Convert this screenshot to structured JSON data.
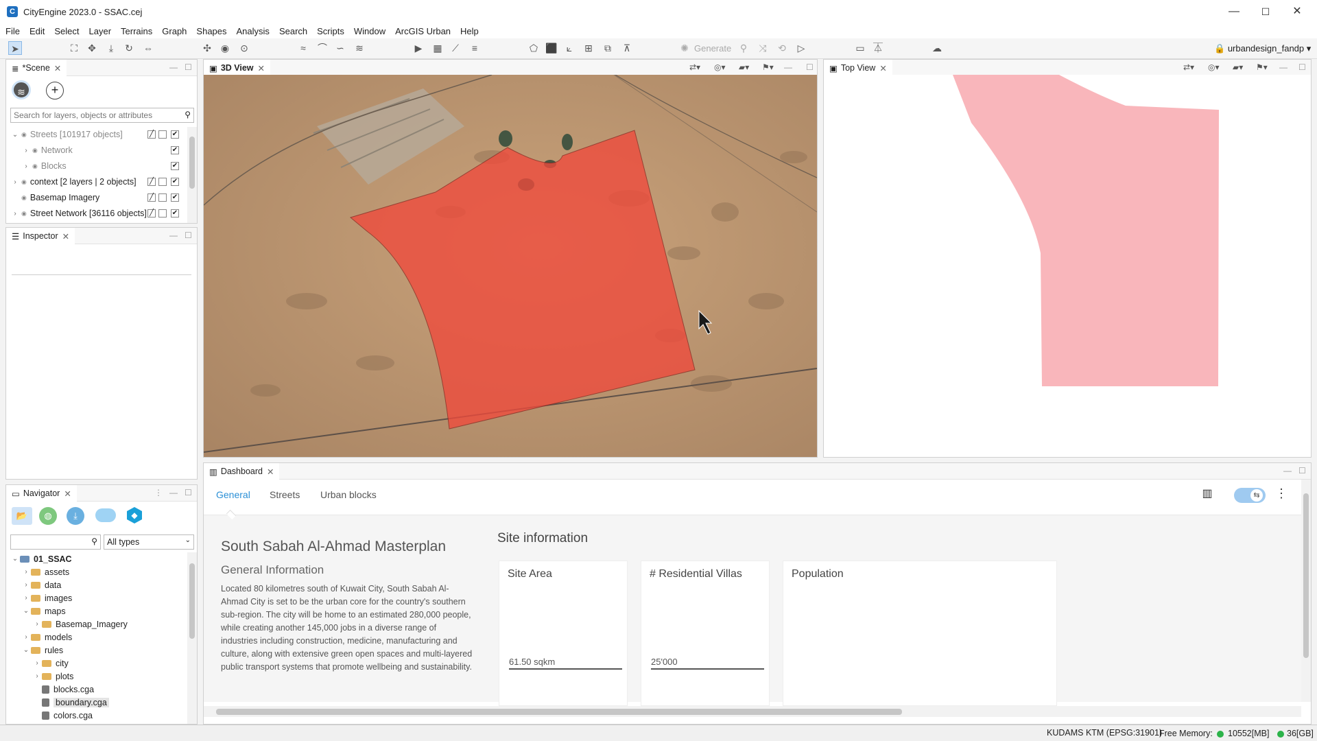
{
  "window": {
    "title": "CityEngine 2023.0 - SSAC.cej",
    "min": "—",
    "max": "☐",
    "close": "✕"
  },
  "menu": [
    "File",
    "Edit",
    "Select",
    "Layer",
    "Terrains",
    "Graph",
    "Shapes",
    "Analysis",
    "Search",
    "Scripts",
    "Window",
    "ArcGIS Urban",
    "Help"
  ],
  "toolbar": {
    "generate_label": "Generate",
    "user": "urbandesign_fandp"
  },
  "scene": {
    "tab": "*Scene",
    "search_placeholder": "Search for layers, objects or attributes",
    "layers": [
      {
        "label": "Streets [101917 objects]",
        "indent": 0,
        "expand": "⌄",
        "dim": true
      },
      {
        "label": "Network",
        "indent": 1,
        "expand": "›",
        "dim": true
      },
      {
        "label": "Blocks",
        "indent": 1,
        "expand": "›",
        "dim": true
      },
      {
        "label": "context [2 layers | 2 objects]",
        "indent": 0,
        "expand": "›",
        "dim": false
      },
      {
        "label": "Basemap Imagery",
        "indent": 0,
        "expand": "",
        "dim": false
      },
      {
        "label": "Street Network [36116 objects]",
        "indent": 0,
        "expand": "›",
        "dim": false
      }
    ]
  },
  "inspector": {
    "tab": "Inspector"
  },
  "navigator": {
    "tab": "Navigator",
    "filter_value": "All types",
    "tree": [
      {
        "label": "01_SSAC",
        "indent": 0,
        "expand": "⌄",
        "kind": "project"
      },
      {
        "label": "assets",
        "indent": 1,
        "expand": "›",
        "kind": "folder"
      },
      {
        "label": "data",
        "indent": 1,
        "expand": "›",
        "kind": "folder"
      },
      {
        "label": "images",
        "indent": 1,
        "expand": "›",
        "kind": "folder"
      },
      {
        "label": "maps",
        "indent": 1,
        "expand": "⌄",
        "kind": "folder"
      },
      {
        "label": "Basemap_Imagery",
        "indent": 2,
        "expand": "›",
        "kind": "folder"
      },
      {
        "label": "models",
        "indent": 1,
        "expand": "›",
        "kind": "folder"
      },
      {
        "label": "rules",
        "indent": 1,
        "expand": "⌄",
        "kind": "folder"
      },
      {
        "label": "city",
        "indent": 2,
        "expand": "›",
        "kind": "folder"
      },
      {
        "label": "plots",
        "indent": 2,
        "expand": "›",
        "kind": "folder"
      },
      {
        "label": "blocks.cga",
        "indent": 2,
        "expand": "",
        "kind": "file"
      },
      {
        "label": "boundary.cga",
        "indent": 2,
        "expand": "",
        "kind": "file",
        "selected": true
      },
      {
        "label": "colors.cga",
        "indent": 2,
        "expand": "",
        "kind": "file"
      }
    ]
  },
  "view3d": {
    "tab": "3D View"
  },
  "topview": {
    "tab": "Top View"
  },
  "dashboard": {
    "tab": "Dashboard",
    "tabs": [
      "General",
      "Streets",
      "Urban blocks"
    ],
    "title": "South Sabah Al-Ahmad Masterplan",
    "subtitle": "General Information",
    "description": "Located 80 kilometres south of Kuwait City, South Sabah Al-Ahmad City is set to be the urban core for the country's southern sub-region. The city will be home to an estimated 280,000 people, while creating another 145,000 jobs in a diverse range of industries including construction, medicine, manufacturing and culture, along with extensive green open spaces and multi-layered public transport systems that promote wellbeing and sustainability.",
    "site_info_title": "Site information",
    "cards": [
      {
        "label": "Site Area",
        "value": "61.50 sqkm"
      },
      {
        "label": "# Residential Villas",
        "value": "25'000"
      },
      {
        "label": "Population",
        "value": ""
      }
    ]
  },
  "status": {
    "crs": "KUDAMS KTM (EPSG:31901)",
    "free_memory_label": "Free Memory:",
    "mem1": "10552[MB]",
    "mem2": "36[GB]"
  },
  "colors": {
    "accent": "#2a8fd6",
    "site_red": "#e8554a",
    "top_pink": "#f9b6bb"
  }
}
